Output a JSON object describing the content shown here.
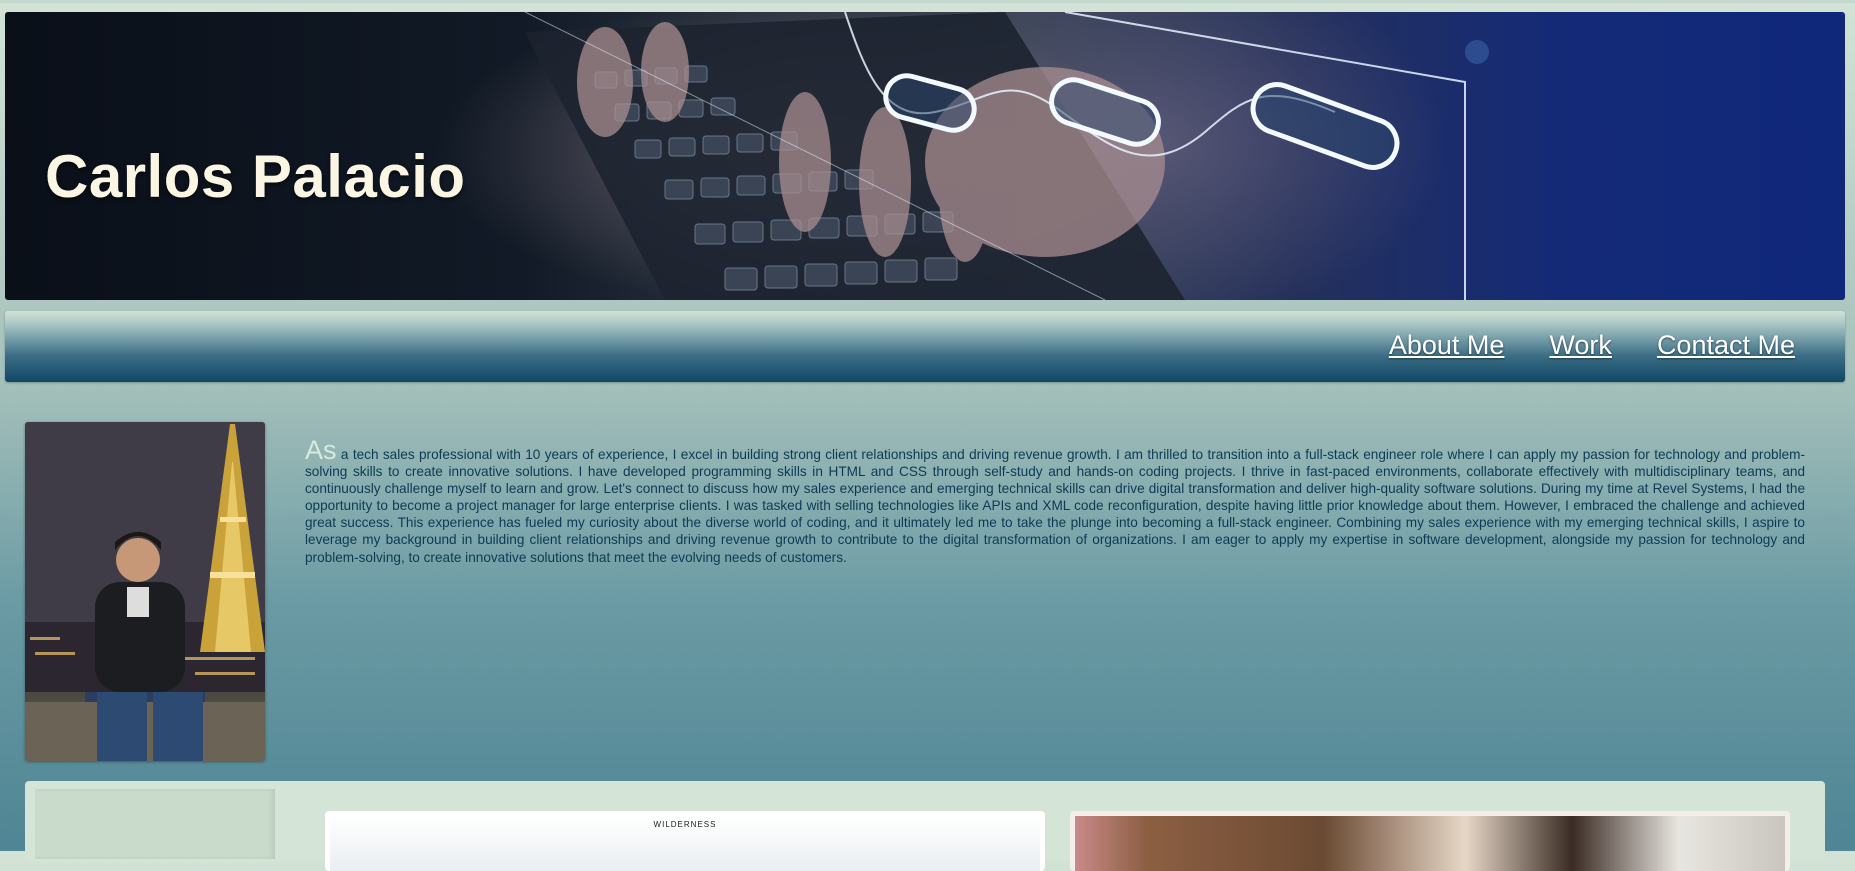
{
  "header": {
    "name": "Carlos Palacio",
    "hero_image": "hands-typing-on-laptop-with-glowing-network-nodes"
  },
  "nav": {
    "items": [
      {
        "label": "About Me"
      },
      {
        "label": "Work"
      },
      {
        "label": "Contact Me"
      }
    ]
  },
  "about": {
    "photo": "man-sitting-in-front-of-eiffel-tower-at-night",
    "dropcap": "As",
    "text": " a tech sales professional with 10 years of experience, I excel in building strong client relationships and driving revenue growth. I am thrilled to transition into a full-stack engineer role where I can apply my passion for technology and problem-solving skills to create innovative solutions. I have developed programming skills in HTML and CSS through self-study and hands-on coding projects. I thrive in fast-paced environments, collaborate effectively with multidisciplinary teams, and continuously challenge myself to learn and grow. Let's connect to discuss how my sales experience and emerging technical skills can drive digital transformation and deliver high-quality software solutions. During my time at Revel Systems, I had the opportunity to become a project manager for large enterprise clients. I was tasked with selling technologies like APIs and XML code reconfiguration, despite having little prior knowledge about them. However, I embraced the challenge and achieved great success. This experience has fueled my curiosity about the diverse world of coding, and it ultimately led me to take the plunge into becoming a full-stack engineer. Combining my sales experience with my emerging technical skills, I aspire to leverage my background in building client relationships and driving revenue growth to contribute to the digital transformation of organizations. I am eager to apply my expertise in software development, alongside my passion for technology and problem-solving, to create innovative solutions that meet the evolving needs of customers."
  },
  "work": {
    "cards": [
      {
        "caption": "WILDERNESS",
        "image": "wilderness-project-screenshot"
      },
      {
        "image": "people-working-in-office-photo"
      }
    ]
  },
  "colors": {
    "title": "#fbf6e4",
    "nav_top": "#d2e2d2",
    "nav_bottom": "#0f4765",
    "body_text": "#0d3a55",
    "dropcap": "#d8eadb",
    "work_bg": "#d4e4d6"
  }
}
